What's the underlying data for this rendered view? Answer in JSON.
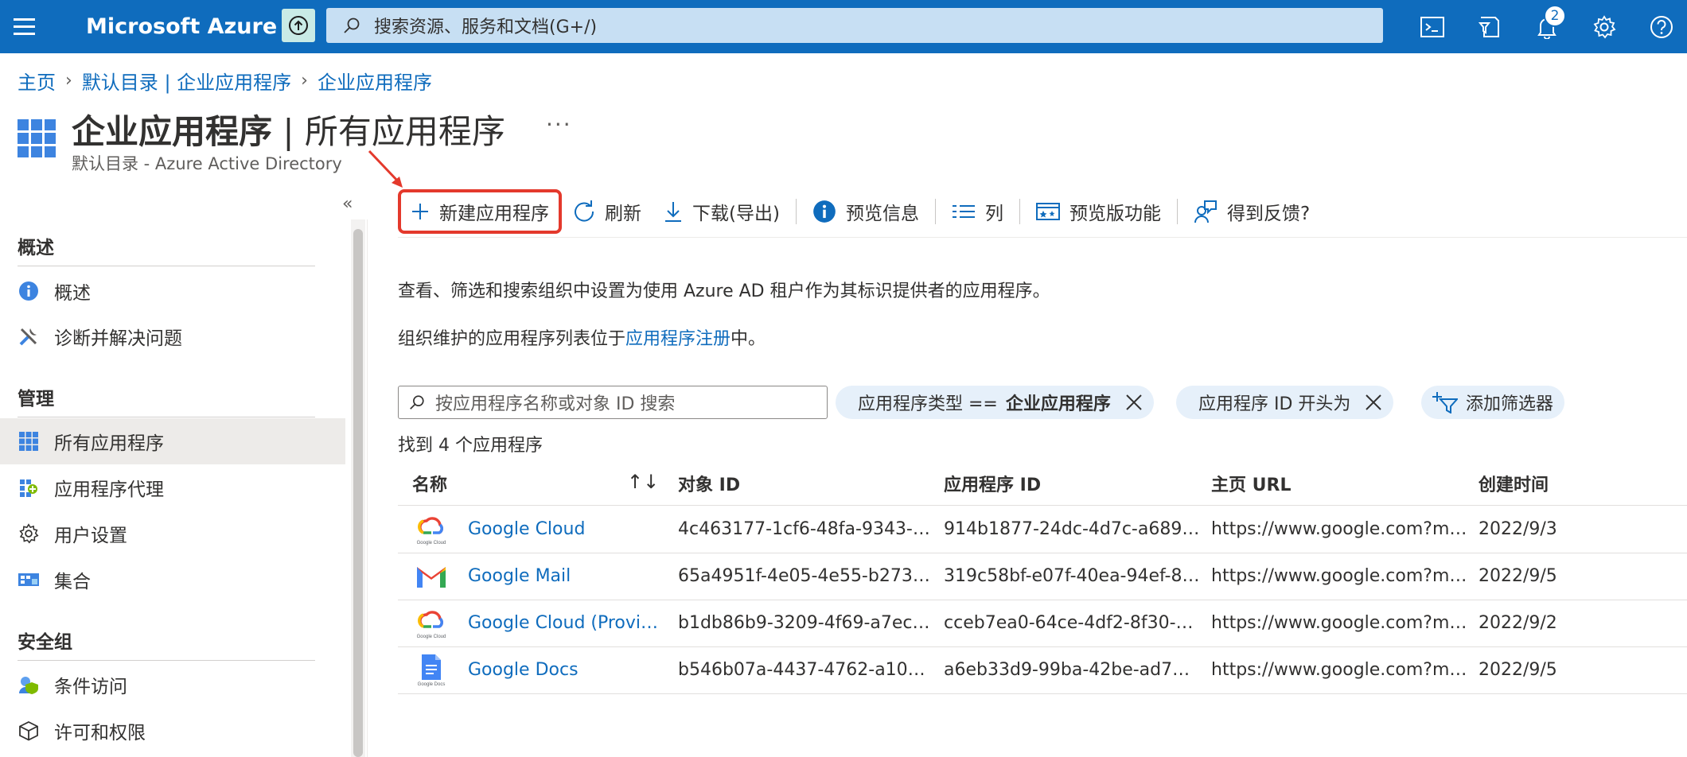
{
  "topbar": {
    "brand": "Microsoft Azure",
    "search_placeholder": "搜索资源、服务和文档(G+/)",
    "notification_count": "2",
    "icons": [
      "menu-icon",
      "upgrade-icon",
      "search-icon",
      "cloud-shell-icon",
      "directory-filter-icon",
      "bell-icon",
      "gear-icon",
      "help-icon"
    ]
  },
  "breadcrumb": [
    "主页",
    "默认目录 | 企业应用程序",
    "企业应用程序"
  ],
  "header": {
    "title_main": "企业应用程序",
    "title_sep": " | ",
    "title_sub": "所有应用程序",
    "more": "···",
    "subtitle": "默认目录 - Azure Active Directory"
  },
  "sidebar": {
    "collapse_glyph": "«",
    "sections": [
      {
        "title": "概述",
        "items": [
          {
            "label": "概述",
            "icon": "info-icon"
          },
          {
            "label": "诊断并解决问题",
            "icon": "wrench-icon"
          }
        ]
      },
      {
        "title": "管理",
        "items": [
          {
            "label": "所有应用程序",
            "icon": "grid-icon",
            "active": true
          },
          {
            "label": "应用程序代理",
            "icon": "proxy-icon"
          },
          {
            "label": "用户设置",
            "icon": "gear-icon"
          },
          {
            "label": "集合",
            "icon": "collection-icon"
          }
        ]
      },
      {
        "title": "安全组",
        "items": [
          {
            "label": "条件访问",
            "icon": "conditional-access-icon"
          },
          {
            "label": "许可和权限",
            "icon": "cube-icon"
          }
        ]
      }
    ]
  },
  "toolbar": {
    "new_app": "新建应用程序",
    "refresh": "刷新",
    "download": "下载(导出)",
    "preview_info": "预览信息",
    "columns": "列",
    "preview_features": "预览版功能",
    "feedback": "得到反馈?"
  },
  "description": {
    "line1": "查看、筛选和搜索组织中设置为使用 Azure AD 租户作为其标识提供者的应用程序。",
    "line2_prefix": "组织维护的应用程序列表位于",
    "line2_link": "应用程序注册",
    "line2_suffix": "中。"
  },
  "filters": {
    "search_placeholder": "按应用程序名称或对象 ID 搜索",
    "pill1_label": "应用程序类型 ==",
    "pill1_value": "企业应用程序",
    "pill2_label": "应用程序 ID 开头为",
    "add_filter": "添加筛选器"
  },
  "count_text": "找到 4 个应用程序",
  "table": {
    "columns": [
      "名称",
      "对象 ID",
      "应用程序 ID",
      "主页 URL",
      "创建时间"
    ],
    "sort_glyph": "↑↓",
    "rows": [
      {
        "name": "Google Cloud",
        "object_id": "4c463177-1cf6-48fa-9343-a...",
        "app_id": "914b1877-24dc-4d7c-a689-...",
        "url": "https://www.google.com?me...",
        "created": "2022/9/3",
        "logo": "google-cloud-logo",
        "logo_caption": "Google Cloud"
      },
      {
        "name": "Google Mail",
        "object_id": "65a4951f-4e05-4e55-b273-c...",
        "app_id": "319c58bf-e07f-40ea-94ef-84...",
        "url": "https://www.google.com?me...",
        "created": "2022/9/5",
        "logo": "gmail-logo",
        "logo_caption": ""
      },
      {
        "name": "Google Cloud (Provisi...",
        "object_id": "b1db86b9-3209-4f69-a7ec-f...",
        "app_id": "cceb7ea0-64ce-4df2-8f30-81...",
        "url": "https://www.google.com?me...",
        "created": "2022/9/2",
        "logo": "google-cloud-logo",
        "logo_caption": "Google Cloud"
      },
      {
        "name": "Google Docs",
        "object_id": "b546b07a-4437-4762-a101-...",
        "app_id": "a6eb33d9-99ba-42be-ad7a-...",
        "url": "https://www.google.com?me...",
        "created": "2022/9/5",
        "logo": "google-docs-logo",
        "logo_caption": "Google Docs"
      }
    ]
  },
  "colors": {
    "topbar": "#0f6cbd",
    "link": "#0f6cbd",
    "annotation": "#e4392c",
    "pill": "#e6f0fa"
  }
}
